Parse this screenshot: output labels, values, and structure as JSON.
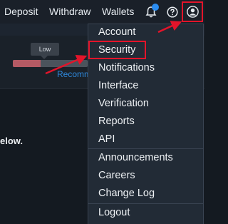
{
  "navbar": {
    "links": [
      "Deposit",
      "Withdraw",
      "Wallets"
    ],
    "icons": [
      "bell-icon",
      "help-icon",
      "user-avatar-icon"
    ]
  },
  "background": {
    "tooltip": "Low",
    "strength_level": 0.37,
    "recommend_text": "Recomm",
    "below_text": "elow."
  },
  "dropdown": {
    "items": [
      "Account",
      "Security",
      "Notifications",
      "Interface",
      "Verification",
      "Reports",
      "API"
    ],
    "items2": [
      "Announcements",
      "Careers",
      "Change Log"
    ],
    "logout": "Logout"
  },
  "colors": {
    "highlight": "#e3142a",
    "accent": "#2b8cf0",
    "background": "#141a21",
    "menu_bg": "#222b36"
  }
}
